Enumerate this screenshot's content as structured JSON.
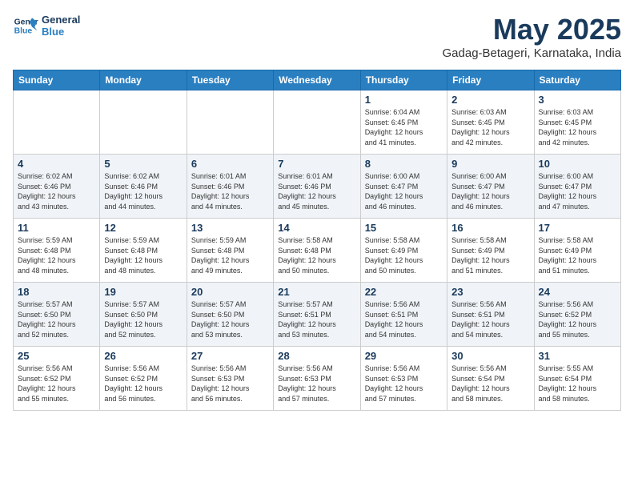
{
  "logo": {
    "line1": "General",
    "line2": "Blue"
  },
  "header": {
    "month_year": "May 2025",
    "location": "Gadag-Betageri, Karnataka, India"
  },
  "days_of_week": [
    "Sunday",
    "Monday",
    "Tuesday",
    "Wednesday",
    "Thursday",
    "Friday",
    "Saturday"
  ],
  "weeks": [
    [
      {
        "num": "",
        "info": ""
      },
      {
        "num": "",
        "info": ""
      },
      {
        "num": "",
        "info": ""
      },
      {
        "num": "",
        "info": ""
      },
      {
        "num": "1",
        "info": "Sunrise: 6:04 AM\nSunset: 6:45 PM\nDaylight: 12 hours\nand 41 minutes."
      },
      {
        "num": "2",
        "info": "Sunrise: 6:03 AM\nSunset: 6:45 PM\nDaylight: 12 hours\nand 42 minutes."
      },
      {
        "num": "3",
        "info": "Sunrise: 6:03 AM\nSunset: 6:45 PM\nDaylight: 12 hours\nand 42 minutes."
      }
    ],
    [
      {
        "num": "4",
        "info": "Sunrise: 6:02 AM\nSunset: 6:46 PM\nDaylight: 12 hours\nand 43 minutes."
      },
      {
        "num": "5",
        "info": "Sunrise: 6:02 AM\nSunset: 6:46 PM\nDaylight: 12 hours\nand 44 minutes."
      },
      {
        "num": "6",
        "info": "Sunrise: 6:01 AM\nSunset: 6:46 PM\nDaylight: 12 hours\nand 44 minutes."
      },
      {
        "num": "7",
        "info": "Sunrise: 6:01 AM\nSunset: 6:46 PM\nDaylight: 12 hours\nand 45 minutes."
      },
      {
        "num": "8",
        "info": "Sunrise: 6:00 AM\nSunset: 6:47 PM\nDaylight: 12 hours\nand 46 minutes."
      },
      {
        "num": "9",
        "info": "Sunrise: 6:00 AM\nSunset: 6:47 PM\nDaylight: 12 hours\nand 46 minutes."
      },
      {
        "num": "10",
        "info": "Sunrise: 6:00 AM\nSunset: 6:47 PM\nDaylight: 12 hours\nand 47 minutes."
      }
    ],
    [
      {
        "num": "11",
        "info": "Sunrise: 5:59 AM\nSunset: 6:48 PM\nDaylight: 12 hours\nand 48 minutes."
      },
      {
        "num": "12",
        "info": "Sunrise: 5:59 AM\nSunset: 6:48 PM\nDaylight: 12 hours\nand 48 minutes."
      },
      {
        "num": "13",
        "info": "Sunrise: 5:59 AM\nSunset: 6:48 PM\nDaylight: 12 hours\nand 49 minutes."
      },
      {
        "num": "14",
        "info": "Sunrise: 5:58 AM\nSunset: 6:48 PM\nDaylight: 12 hours\nand 50 minutes."
      },
      {
        "num": "15",
        "info": "Sunrise: 5:58 AM\nSunset: 6:49 PM\nDaylight: 12 hours\nand 50 minutes."
      },
      {
        "num": "16",
        "info": "Sunrise: 5:58 AM\nSunset: 6:49 PM\nDaylight: 12 hours\nand 51 minutes."
      },
      {
        "num": "17",
        "info": "Sunrise: 5:58 AM\nSunset: 6:49 PM\nDaylight: 12 hours\nand 51 minutes."
      }
    ],
    [
      {
        "num": "18",
        "info": "Sunrise: 5:57 AM\nSunset: 6:50 PM\nDaylight: 12 hours\nand 52 minutes."
      },
      {
        "num": "19",
        "info": "Sunrise: 5:57 AM\nSunset: 6:50 PM\nDaylight: 12 hours\nand 52 minutes."
      },
      {
        "num": "20",
        "info": "Sunrise: 5:57 AM\nSunset: 6:50 PM\nDaylight: 12 hours\nand 53 minutes."
      },
      {
        "num": "21",
        "info": "Sunrise: 5:57 AM\nSunset: 6:51 PM\nDaylight: 12 hours\nand 53 minutes."
      },
      {
        "num": "22",
        "info": "Sunrise: 5:56 AM\nSunset: 6:51 PM\nDaylight: 12 hours\nand 54 minutes."
      },
      {
        "num": "23",
        "info": "Sunrise: 5:56 AM\nSunset: 6:51 PM\nDaylight: 12 hours\nand 54 minutes."
      },
      {
        "num": "24",
        "info": "Sunrise: 5:56 AM\nSunset: 6:52 PM\nDaylight: 12 hours\nand 55 minutes."
      }
    ],
    [
      {
        "num": "25",
        "info": "Sunrise: 5:56 AM\nSunset: 6:52 PM\nDaylight: 12 hours\nand 55 minutes."
      },
      {
        "num": "26",
        "info": "Sunrise: 5:56 AM\nSunset: 6:52 PM\nDaylight: 12 hours\nand 56 minutes."
      },
      {
        "num": "27",
        "info": "Sunrise: 5:56 AM\nSunset: 6:53 PM\nDaylight: 12 hours\nand 56 minutes."
      },
      {
        "num": "28",
        "info": "Sunrise: 5:56 AM\nSunset: 6:53 PM\nDaylight: 12 hours\nand 57 minutes."
      },
      {
        "num": "29",
        "info": "Sunrise: 5:56 AM\nSunset: 6:53 PM\nDaylight: 12 hours\nand 57 minutes."
      },
      {
        "num": "30",
        "info": "Sunrise: 5:56 AM\nSunset: 6:54 PM\nDaylight: 12 hours\nand 58 minutes."
      },
      {
        "num": "31",
        "info": "Sunrise: 5:55 AM\nSunset: 6:54 PM\nDaylight: 12 hours\nand 58 minutes."
      }
    ]
  ]
}
